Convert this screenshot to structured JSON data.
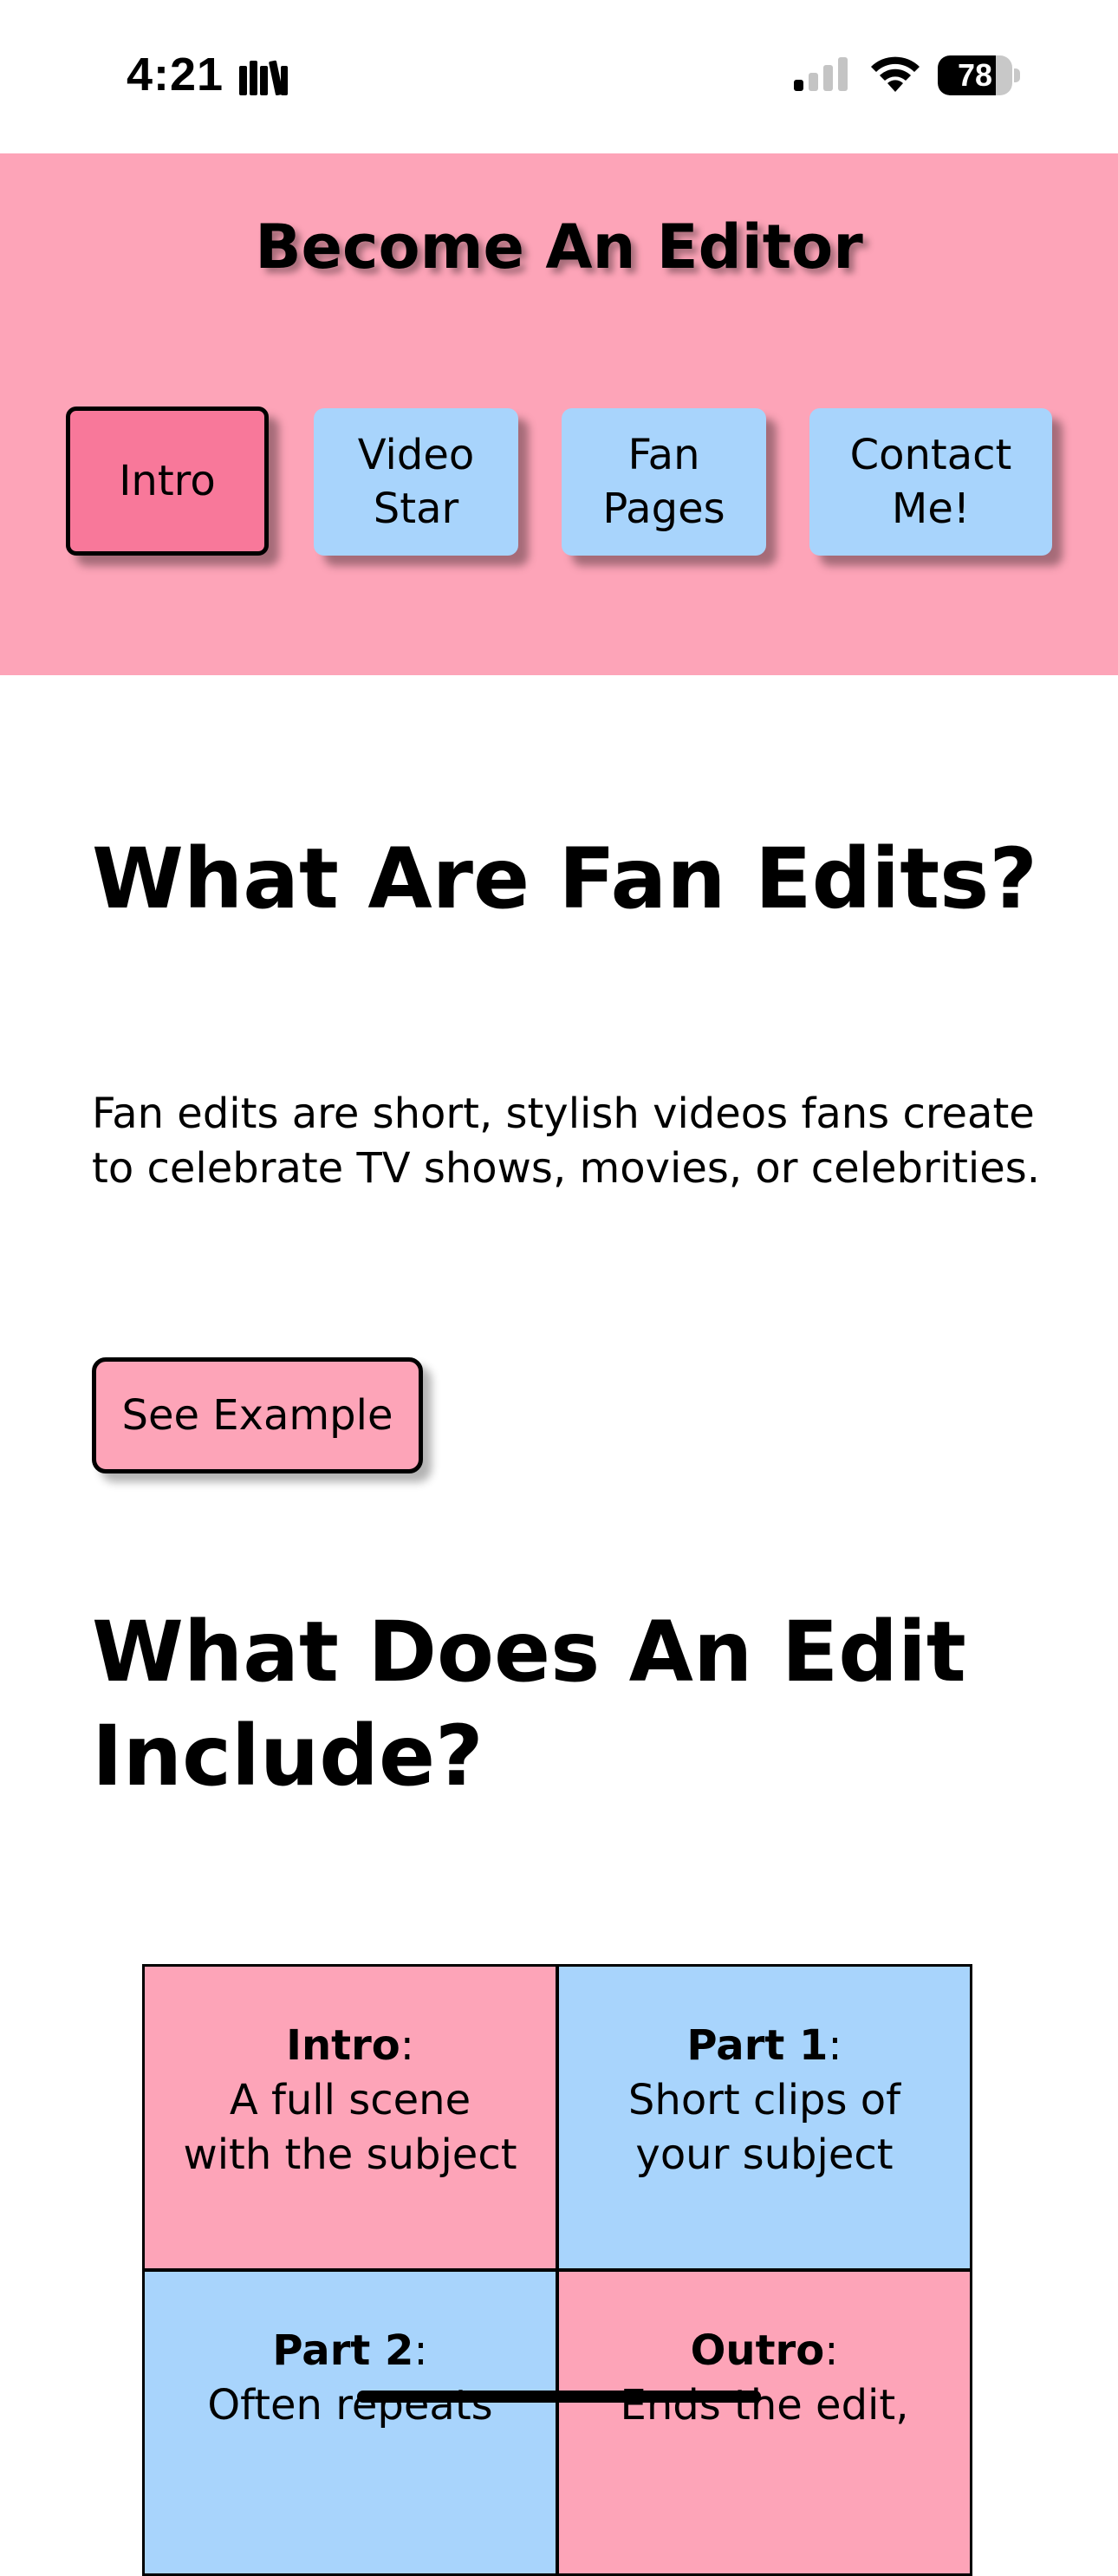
{
  "status_bar": {
    "time": "4:21",
    "battery_level": "78",
    "battery_fraction": 0.78
  },
  "header": {
    "title": "Become An Editor",
    "nav": [
      {
        "label": "Intro",
        "active": true
      },
      {
        "label": "Video Star",
        "active": false
      },
      {
        "label": "Fan Pages",
        "active": false
      },
      {
        "label": "Contact Me!",
        "active": false
      }
    ]
  },
  "main": {
    "section1": {
      "heading": "What Are Fan Edits?",
      "paragraph": "Fan edits are short, stylish videos fans create to celebrate TV shows, movies, or celebrities.",
      "button_label": "See Example"
    },
    "section2": {
      "heading": "What Does An Edit Include?",
      "parts": [
        {
          "name": "Intro",
          "description": "A full scene with the subject",
          "color": "#fda4b8"
        },
        {
          "name": "Part 1",
          "description": "Short clips of your subject",
          "color": "#a8d4fc"
        },
        {
          "name": "Part 2",
          "description": "Often repeats",
          "color": "#a8d4fc"
        },
        {
          "name": "Outro",
          "description": "Ends the edit,",
          "color": "#fda4b8"
        }
      ]
    }
  },
  "colors": {
    "pink": "#fda4b8",
    "active_pink": "#f8789a",
    "blue": "#a8d4fc"
  }
}
